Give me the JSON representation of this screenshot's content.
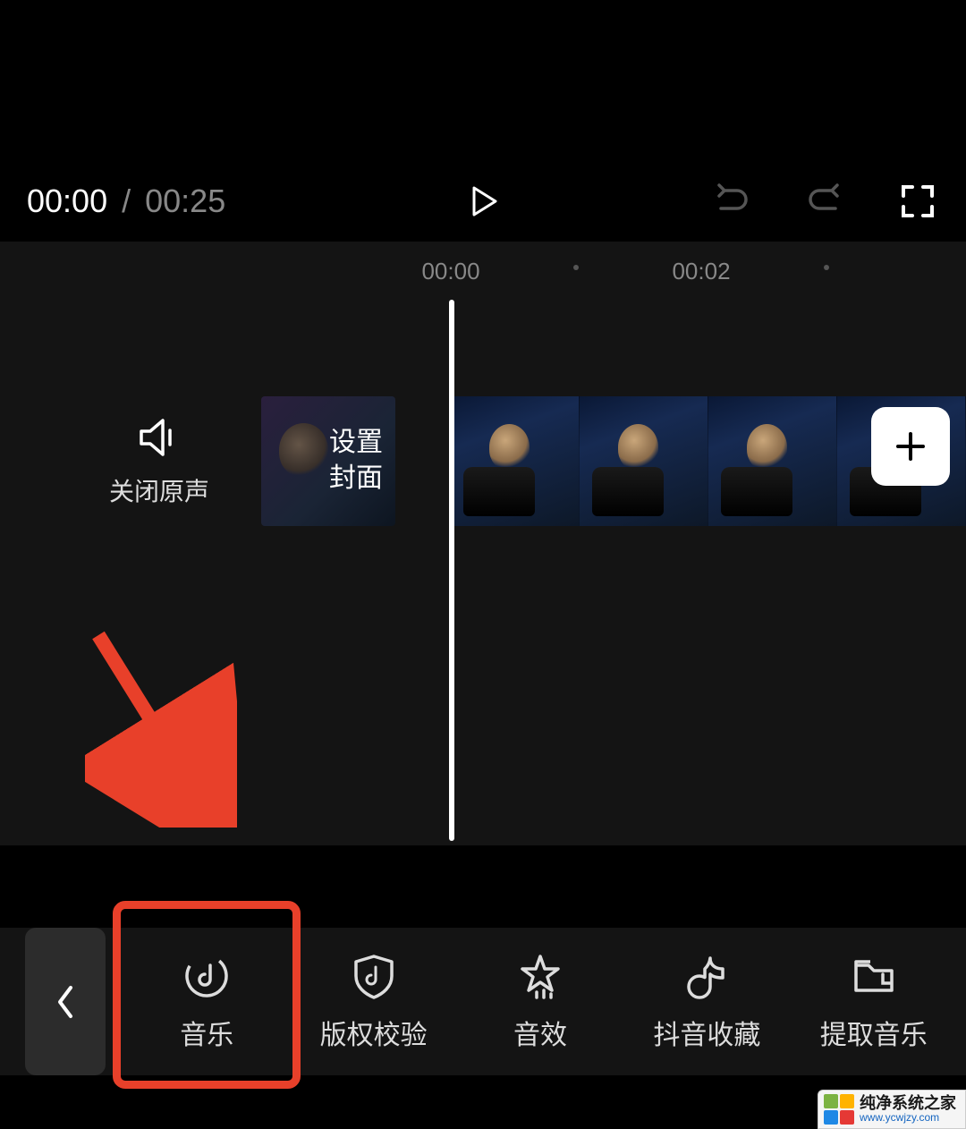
{
  "playback": {
    "current": "00:00",
    "separator": "/",
    "total": "00:25"
  },
  "ruler": {
    "marks": [
      "00:00",
      "00:02"
    ]
  },
  "track": {
    "mute_label": "关闭原声",
    "cover_line1": "设置",
    "cover_line2": "封面"
  },
  "toolbar": {
    "items": [
      {
        "icon": "music-disc-icon",
        "label": "音乐"
      },
      {
        "icon": "shield-music-icon",
        "label": "版权校验"
      },
      {
        "icon": "star-bars-icon",
        "label": "音效"
      },
      {
        "icon": "douyin-icon",
        "label": "抖音收藏"
      },
      {
        "icon": "folder-extract-icon",
        "label": "提取音乐"
      }
    ]
  },
  "watermark": {
    "title": "纯净系统之家",
    "url": "www.ycwjzy.com"
  }
}
